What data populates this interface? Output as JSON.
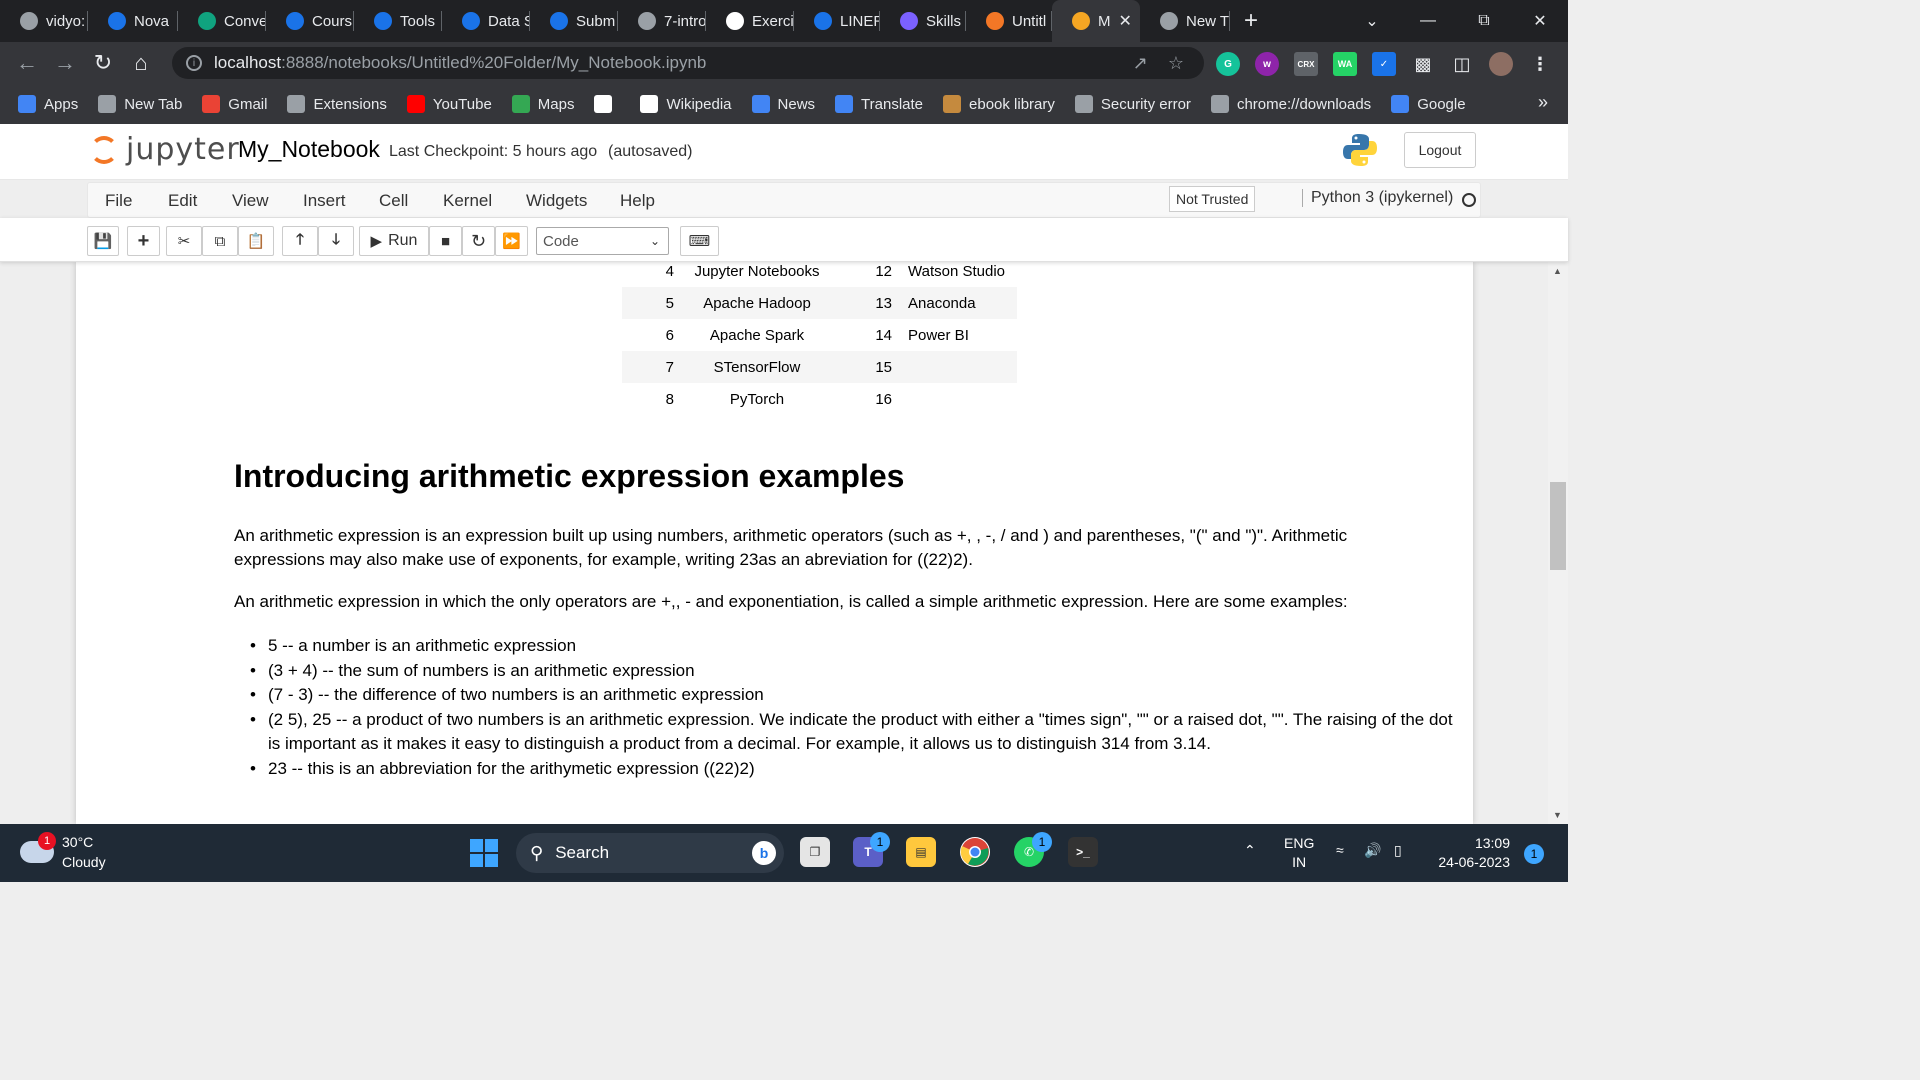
{
  "tabs": [
    {
      "label": "vidyo:",
      "icon": "globe-icon",
      "color": "#9aa0a6"
    },
    {
      "label": "Nova",
      "icon": "play-icon",
      "color": "#1a73e8"
    },
    {
      "label": "Conve",
      "icon": "chatgpt-icon",
      "color": "#10a37f"
    },
    {
      "label": "Cours",
      "icon": "c-icon",
      "color": "#1a73e8"
    },
    {
      "label": "Tools",
      "icon": "c-icon",
      "color": "#1a73e8"
    },
    {
      "label": "Data S",
      "icon": "c-icon",
      "color": "#1a73e8"
    },
    {
      "label": "Subm",
      "icon": "c-icon",
      "color": "#1a73e8"
    },
    {
      "label": "7-intro",
      "icon": "globe-icon",
      "color": "#9aa0a6"
    },
    {
      "label": "Exerci",
      "icon": "github-icon",
      "color": "#ffffff"
    },
    {
      "label": "LINER",
      "icon": "liner-icon",
      "color": "#1a73e8"
    },
    {
      "label": "Skills",
      "icon": "skills-icon",
      "color": "#7b61ff"
    },
    {
      "label": "Untitl",
      "icon": "jupyter-icon",
      "color": "#f37726"
    },
    {
      "label": "M",
      "icon": "notebook-icon",
      "color": "#f5a623",
      "active": true
    },
    {
      "label": "New T",
      "icon": "chrome-icon",
      "color": "#9aa0a6"
    }
  ],
  "address": {
    "host": "localhost",
    "path": ":8888/notebooks/Untitled%20Folder/My_Notebook.ipynb"
  },
  "bookmarks": [
    {
      "label": "Apps",
      "icon": "apps-grid-icon",
      "color": "#4285f4"
    },
    {
      "label": "New Tab",
      "icon": "globe-icon",
      "color": "#9aa0a6"
    },
    {
      "label": "Gmail",
      "icon": "gmail-icon",
      "color": "#ea4335"
    },
    {
      "label": "Extensions",
      "icon": "puzzle-icon",
      "color": "#9aa0a6"
    },
    {
      "label": "YouTube",
      "icon": "youtube-icon",
      "color": "#ff0000"
    },
    {
      "label": "Maps",
      "icon": "maps-pin-icon",
      "color": "#34a853"
    },
    {
      "label": "",
      "icon": "wikipedia-icon",
      "color": "#ffffff"
    },
    {
      "label": "Wikipedia",
      "icon": "wikipedia-icon",
      "color": "#ffffff"
    },
    {
      "label": "News",
      "icon": "news-icon",
      "color": "#4285f4"
    },
    {
      "label": "Translate",
      "icon": "translate-icon",
      "color": "#4285f4"
    },
    {
      "label": "ebook library",
      "icon": "ebook-icon",
      "color": "#c58a3e"
    },
    {
      "label": "Security error",
      "icon": "globe-icon",
      "color": "#9aa0a6"
    },
    {
      "label": "chrome://downloads",
      "icon": "download-icon",
      "color": "#9aa0a6"
    },
    {
      "label": "Google",
      "icon": "google-icon",
      "color": "#4285f4"
    }
  ],
  "jupyter": {
    "logo_text": "jupyter",
    "notebook_name": "My_Notebook",
    "checkpoint": "Last Checkpoint: 5 hours ago",
    "autosaved": "(autosaved)",
    "logout": "Logout"
  },
  "menu": {
    "items": [
      "File",
      "Edit",
      "View",
      "Insert",
      "Cell",
      "Kernel",
      "Widgets",
      "Help"
    ],
    "trusted": "Not Trusted",
    "kernel": "Python 3 (ipykernel)"
  },
  "toolbar": {
    "run_label": "Run",
    "cell_type": "Code"
  },
  "tools_table": [
    {
      "n1": "4",
      "name1": "Jupyter Notebooks",
      "n2": "12",
      "name2": "Watson Studio"
    },
    {
      "n1": "5",
      "name1": "Apache Hadoop",
      "n2": "13",
      "name2": "Anaconda"
    },
    {
      "n1": "6",
      "name1": "Apache Spark",
      "n2": "14",
      "name2": "Power BI"
    },
    {
      "n1": "7",
      "name1": "STensorFlow",
      "n2": "15",
      "name2": ""
    },
    {
      "n1": "8",
      "name1": "PyTorch",
      "n2": "16",
      "name2": ""
    }
  ],
  "content": {
    "heading": "Introducing arithmetic expression examples",
    "para1": "An arithmetic expression is an expression built up using numbers, arithmetic operators (such as +, , -, / and ) and parentheses, \"(\" and \")\". Arithmetic expressions may also make use of exponents, for example, writing 23as an abreviation for ((22)2).",
    "para2": "An arithmetic expression in which the only operators are +,, - and exponentiation, is called a simple arithmetic expression. Here are some examples:",
    "bullets": [
      "5 -- a number is an arithmetic expression",
      "(3 + 4) -- the sum of numbers is an arithmetic expression",
      "(7 - 3) -- the difference of two numbers is an arithmetic expression",
      "(2 5), 25 -- a product of two numbers is an arithmetic expression. We indicate the product with either a \"times sign\", \"\" or a raised dot, \"\". The raising of the dot is important as it makes it easy to distinguish a product from a decimal. For example, it allows us to distinguish 314 from 3.14.",
      "23 -- this is an abbreviation for the arithymetic expression ((22)2)"
    ]
  },
  "taskbar": {
    "temp": "30°C",
    "weather": "Cloudy",
    "weather_badge": "1",
    "search": "Search",
    "lang1": "ENG",
    "lang2": "IN",
    "time": "13:09",
    "date": "24-06-2023",
    "notif_count": "1",
    "teams_badge": "1",
    "whatsapp_badge": "1"
  }
}
